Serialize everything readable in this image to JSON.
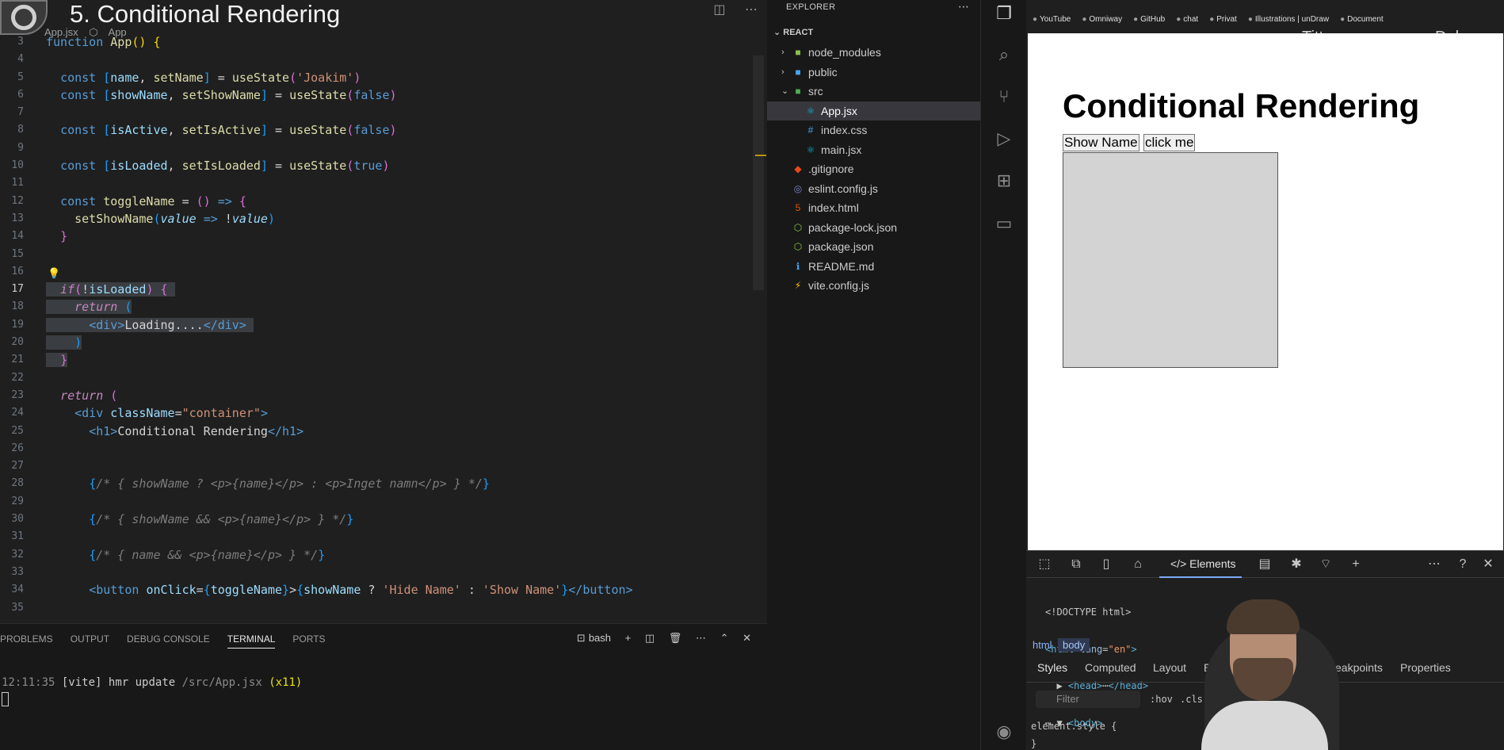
{
  "video": {
    "title": "5. Conditional Rendering"
  },
  "editor": {
    "breadcrumb": [
      "App.jsx",
      "App"
    ],
    "lines": [
      {
        "n": "3",
        "html": "<span class=\"k\">function</span> <span class=\"fn\">App</span><span class=\"by\">()</span> <span class=\"by\">{</span>"
      },
      {
        "n": "4",
        "html": ""
      },
      {
        "n": "5",
        "html": "  <span class=\"k\">const</span> <span class=\"bb\">[</span><span class=\"v\">name</span>, <span class=\"fn\">setName</span><span class=\"bb\">]</span> = <span class=\"fn\">useState</span><span class=\"br\">(</span><span class=\"s\">'Joakim'</span><span class=\"br\">)</span>"
      },
      {
        "n": "6",
        "html": "  <span class=\"k\">const</span> <span class=\"bb\">[</span><span class=\"v\">showName</span>, <span class=\"fn\">setShowName</span><span class=\"bb\">]</span> = <span class=\"fn\">useState</span><span class=\"br\">(</span><span class=\"k\">false</span><span class=\"br\">)</span>"
      },
      {
        "n": "7",
        "html": ""
      },
      {
        "n": "8",
        "html": "  <span class=\"k\">const</span> <span class=\"bb\">[</span><span class=\"v\">isActive</span>, <span class=\"fn\">setIsActive</span><span class=\"bb\">]</span> = <span class=\"fn\">useState</span><span class=\"br\">(</span><span class=\"k\">false</span><span class=\"br\">)</span>"
      },
      {
        "n": "9",
        "html": ""
      },
      {
        "n": "10",
        "html": "  <span class=\"k\">const</span> <span class=\"bb\">[</span><span class=\"v\">isLoaded</span>, <span class=\"fn\">setIsLoaded</span><span class=\"bb\">]</span> = <span class=\"fn\">useState</span><span class=\"br\">(</span><span class=\"k\">true</span><span class=\"br\">)</span>"
      },
      {
        "n": "11",
        "html": ""
      },
      {
        "n": "12",
        "html": "  <span class=\"k\">const</span> <span class=\"fn\">toggleName</span> = <span class=\"br\">()</span> <span class=\"k\">=&gt;</span> <span class=\"br\">{</span>"
      },
      {
        "n": "13",
        "html": "    <span class=\"fn\">setShowName</span><span class=\"bb\">(</span><span class=\"vi\">value</span> <span class=\"k\">=&gt;</span> !<span class=\"vi\">value</span><span class=\"bb\">)</span>"
      },
      {
        "n": "14",
        "html": "  <span class=\"br\">}</span>"
      },
      {
        "n": "15",
        "html": ""
      },
      {
        "n": "16",
        "html": "",
        "bulb": true
      },
      {
        "n": "17",
        "html": "<span class=\"sel\">  <span class=\"kc\">if</span><span class=\"br\">(</span>!<span class=\"v\">isLoaded</span><span class=\"br\">)</span> <span class=\"br\">{</span> </span>",
        "cur": true
      },
      {
        "n": "18",
        "html": "<span class=\"sel\">    <span class=\"kc\">return</span> <span class=\"bb\">(</span></span>"
      },
      {
        "n": "19",
        "html": "<span class=\"sel\">      <span class=\"t\">&lt;</span><span class=\"t\">div</span><span class=\"t\">&gt;</span>Loading....<span class=\"t\">&lt;/</span><span class=\"t\">div</span><span class=\"t\">&gt;</span> </span>"
      },
      {
        "n": "20",
        "html": "<span class=\"sel\">    <span class=\"bb\">)</span></span>"
      },
      {
        "n": "21",
        "html": "<span class=\"sel\">  <span class=\"br\">}</span></span>"
      },
      {
        "n": "22",
        "html": ""
      },
      {
        "n": "23",
        "html": "  <span class=\"kc\">return</span> <span class=\"br\">(</span>"
      },
      {
        "n": "24",
        "html": "    <span class=\"t\">&lt;</span><span class=\"t\">div</span> <span class=\"v\">className</span>=<span class=\"s\">\"container\"</span><span class=\"t\">&gt;</span>"
      },
      {
        "n": "25",
        "html": "      <span class=\"t\">&lt;</span><span class=\"t\">h1</span><span class=\"t\">&gt;</span>Conditional Rendering<span class=\"t\">&lt;/</span><span class=\"t\">h1</span><span class=\"t\">&gt;</span>"
      },
      {
        "n": "26",
        "html": ""
      },
      {
        "n": "27",
        "html": ""
      },
      {
        "n": "28",
        "html": "      <span class=\"bb\">{</span><span class=\"cg\">/* { showName ? &lt;p&gt;{name}&lt;/p&gt; : &lt;p&gt;Inget namn&lt;/p&gt; } */</span><span class=\"bb\">}</span>"
      },
      {
        "n": "29",
        "html": ""
      },
      {
        "n": "30",
        "html": "      <span class=\"bb\">{</span><span class=\"cg\">/* { showName &amp;&amp; &lt;p&gt;{name}&lt;/p&gt; } */</span><span class=\"bb\">}</span>"
      },
      {
        "n": "31",
        "html": ""
      },
      {
        "n": "32",
        "html": "      <span class=\"bb\">{</span><span class=\"cg\">/* { name &amp;&amp; &lt;p&gt;{name}&lt;/p&gt; } */</span><span class=\"bb\">}</span>"
      },
      {
        "n": "33",
        "html": ""
      },
      {
        "n": "34",
        "html": "      <span class=\"t\">&lt;</span><span class=\"t\">button</span> <span class=\"v\">onClick</span>=<span class=\"bb\">{</span><span class=\"v\">toggleName</span><span class=\"bb\">}</span>&gt;<span class=\"bb\">{</span><span class=\"v\">showName</span> ? <span class=\"s\">'Hide Name'</span> : <span class=\"s\">'Show Name'</span><span class=\"bb\">}</span><span class=\"t\">&lt;/</span><span class=\"t\">button</span><span class=\"t\">&gt;</span>"
      },
      {
        "n": "35",
        "html": ""
      }
    ]
  },
  "panel": {
    "tabs": [
      "PROBLEMS",
      "OUTPUT",
      "DEBUG CONSOLE",
      "TERMINAL",
      "PORTS"
    ],
    "active_tab": "TERMINAL",
    "shell": "bash",
    "terminal": {
      "time": "12:11:35",
      "tag": "[vite]",
      "msg": "hmr update",
      "path": "/src/App.jsx",
      "count": "(x11)"
    }
  },
  "explorer": {
    "title": "EXPLORER",
    "section": "REACT",
    "items": [
      {
        "label": "node_modules",
        "depth": 0,
        "chev": "›",
        "icon": "■",
        "icolor": "#8bc34a",
        "name": "node-modules"
      },
      {
        "label": "public",
        "depth": 0,
        "chev": "›",
        "icon": "■",
        "icolor": "#42a5f5",
        "name": "public"
      },
      {
        "label": "src",
        "depth": 0,
        "chev": "⌄",
        "icon": "■",
        "icolor": "#4caf50",
        "name": "src"
      },
      {
        "label": "App.jsx",
        "depth": 1,
        "icon": "⚛",
        "icolor": "#00bcd4",
        "name": "app-jsx",
        "active": true
      },
      {
        "label": "index.css",
        "depth": 1,
        "icon": "#",
        "icolor": "#42a5f5",
        "name": "index-css"
      },
      {
        "label": "main.jsx",
        "depth": 1,
        "icon": "⚛",
        "icolor": "#00bcd4",
        "name": "main-jsx"
      },
      {
        "label": ".gitignore",
        "depth": 0,
        "icon": "◆",
        "icolor": "#e64a19",
        "name": "gitignore"
      },
      {
        "label": "eslint.config.js",
        "depth": 0,
        "icon": "◎",
        "icolor": "#7986cb",
        "name": "eslint-config"
      },
      {
        "label": "index.html",
        "depth": 0,
        "icon": "5",
        "icolor": "#e65100",
        "name": "index-html"
      },
      {
        "label": "package-lock.json",
        "depth": 0,
        "icon": "⬡",
        "icolor": "#8bc34a",
        "name": "package-lock"
      },
      {
        "label": "package.json",
        "depth": 0,
        "icon": "⬡",
        "icolor": "#8bc34a",
        "name": "package-json"
      },
      {
        "label": "README.md",
        "depth": 0,
        "icon": "ℹ",
        "icolor": "#42a5f5",
        "name": "readme"
      },
      {
        "label": "vite.config.js",
        "depth": 0,
        "icon": "⚡",
        "icolor": "#ffc107",
        "name": "vite-config"
      }
    ]
  },
  "browser": {
    "bookmarks": [
      "YouTube",
      "Omniway",
      "GitHub",
      "chat",
      "Privat",
      "Illustrations | unDraw",
      "Document"
    ],
    "overlay_left": "Titta senare",
    "overlay_right": "Dela",
    "page": {
      "heading": "Conditional Rendering",
      "btn1": "Show Name",
      "btn2": "click me"
    }
  },
  "devtools": {
    "active_tab": "Elements",
    "dom": [
      "<!DOCTYPE html>",
      "html",
      "lang",
      "\"en\"",
      "head",
      "body"
    ],
    "crumbs": [
      "html",
      "body"
    ],
    "style_tabs": [
      "Styles",
      "Computed",
      "Layout",
      "Ev",
      "Breakpoints",
      "Properties"
    ],
    "filter_placeholder": "Filter",
    "hov": ":hov",
    "cls": ".cls",
    "element_style": "element.style {",
    "element_style_end": "}"
  }
}
